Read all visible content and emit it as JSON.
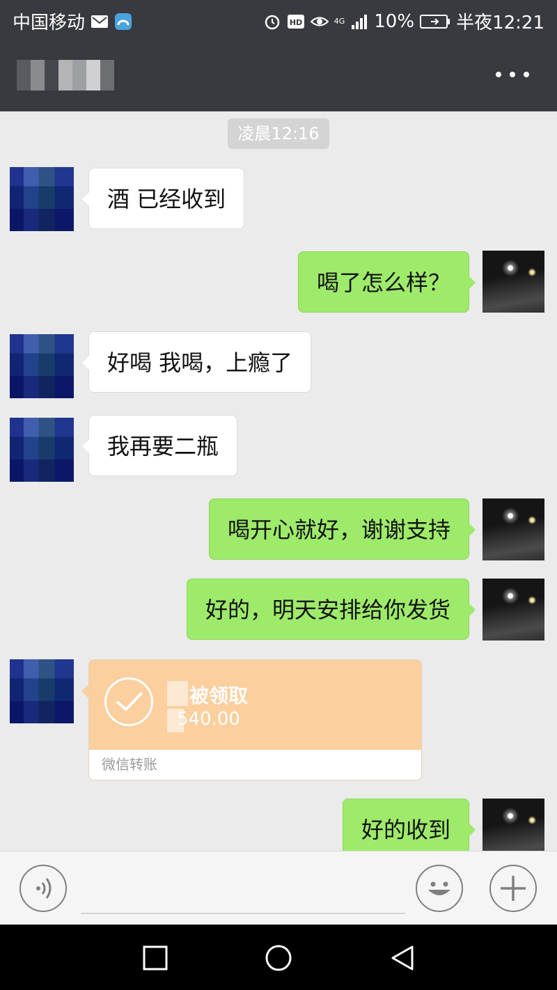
{
  "status_bar": {
    "carrier": "中国移动",
    "network": "4G",
    "battery": "10%",
    "time": "半夜12:21",
    "icons": [
      "mail-icon",
      "app-icon",
      "alarm-icon",
      "hd-icon",
      "eye-icon",
      "signal-icon",
      "battery-icon"
    ]
  },
  "header": {
    "contact_name": "",
    "more_icon": "more-icon"
  },
  "chat": {
    "timestamp": "凌晨12:16",
    "messages": [
      {
        "sender": "other",
        "text": "酒 已经收到"
      },
      {
        "sender": "me",
        "text": "喝了怎么样？"
      },
      {
        "sender": "other",
        "text": "好喝 我喝，上瘾了"
      },
      {
        "sender": "other",
        "text": "我再要二瓶"
      },
      {
        "sender": "me",
        "text": "喝开心就好，谢谢支持"
      },
      {
        "sender": "me",
        "text": "好的，明天安排给你发货"
      },
      {
        "sender": "me",
        "text": "好的收到"
      }
    ],
    "transfer": {
      "status": "被领取",
      "amount": "540.00",
      "label": "微信转账",
      "icon": "check-icon"
    }
  },
  "input_bar": {
    "placeholder": "",
    "icons": [
      "voice-icon",
      "emoji-icon",
      "plus-icon"
    ]
  },
  "nav_bar": {
    "icons": [
      "recent-apps-icon",
      "home-icon",
      "back-icon"
    ]
  },
  "colors": {
    "bar_dark": "#393a3f",
    "chat_background": "#ebebeb",
    "my_bubble": "#9eea6a",
    "other_bubble": "#ffffff",
    "transfer": "#fbcf9e"
  }
}
